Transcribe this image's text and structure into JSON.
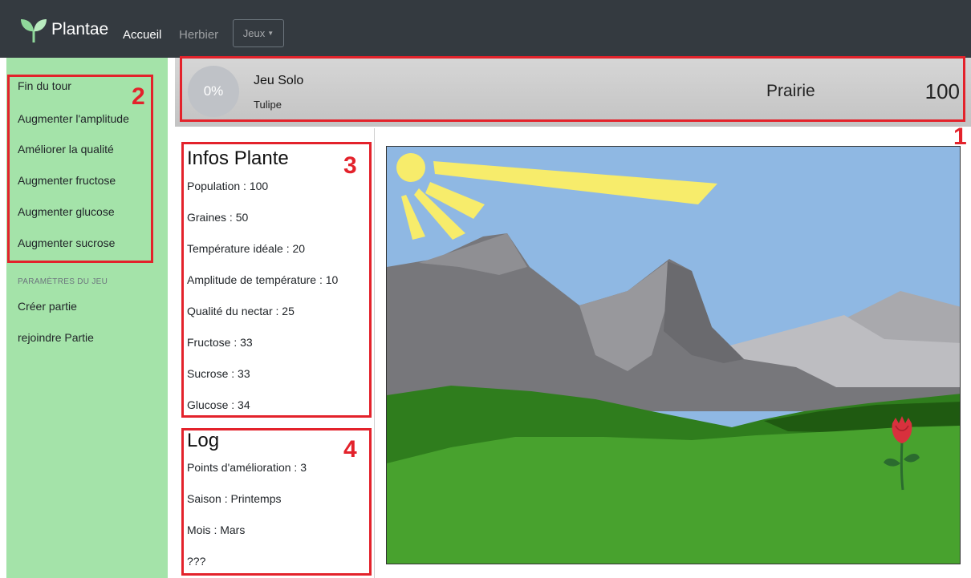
{
  "navbar": {
    "brand": "Plantae",
    "home": "Accueil",
    "herbier": "Herbier",
    "games_dropdown": "Jeux"
  },
  "sidebar": {
    "actions": [
      "Fin du tour",
      "Augmenter l'amplitude",
      "Améliorer la qualité",
      "Augmenter fructose",
      "Augmenter glucose",
      "Augmenter sucrose"
    ],
    "settings_heading": "PARAMÈTRES DU JEU",
    "settings": [
      "Créer partie",
      "rejoindre Partie"
    ]
  },
  "header": {
    "progress": "0%",
    "mode": "Jeu Solo",
    "plant": "Tulipe",
    "biome": "Prairie",
    "score": "100"
  },
  "plant_info": {
    "title": "Infos Plante",
    "lines": [
      "Population : 100",
      "Graines : 50",
      "Température idéale : 20",
      "Amplitude de température : 10",
      "Qualité du nectar : 25",
      "Fructose : 33",
      "Sucrose : 33",
      "Glucose : 34"
    ]
  },
  "log": {
    "title": "Log",
    "lines": [
      "Points d'amélioration : 3",
      "Saison : Printemps",
      "Mois : Mars",
      "???"
    ]
  },
  "annotations": [
    "1",
    "2",
    "3",
    "4"
  ],
  "colors": {
    "annotation": "#e3222b",
    "sidebar": "#a4e3a9",
    "navbar": "#343a40",
    "sky": "#8fb8e3",
    "grass": "#48a22e"
  }
}
